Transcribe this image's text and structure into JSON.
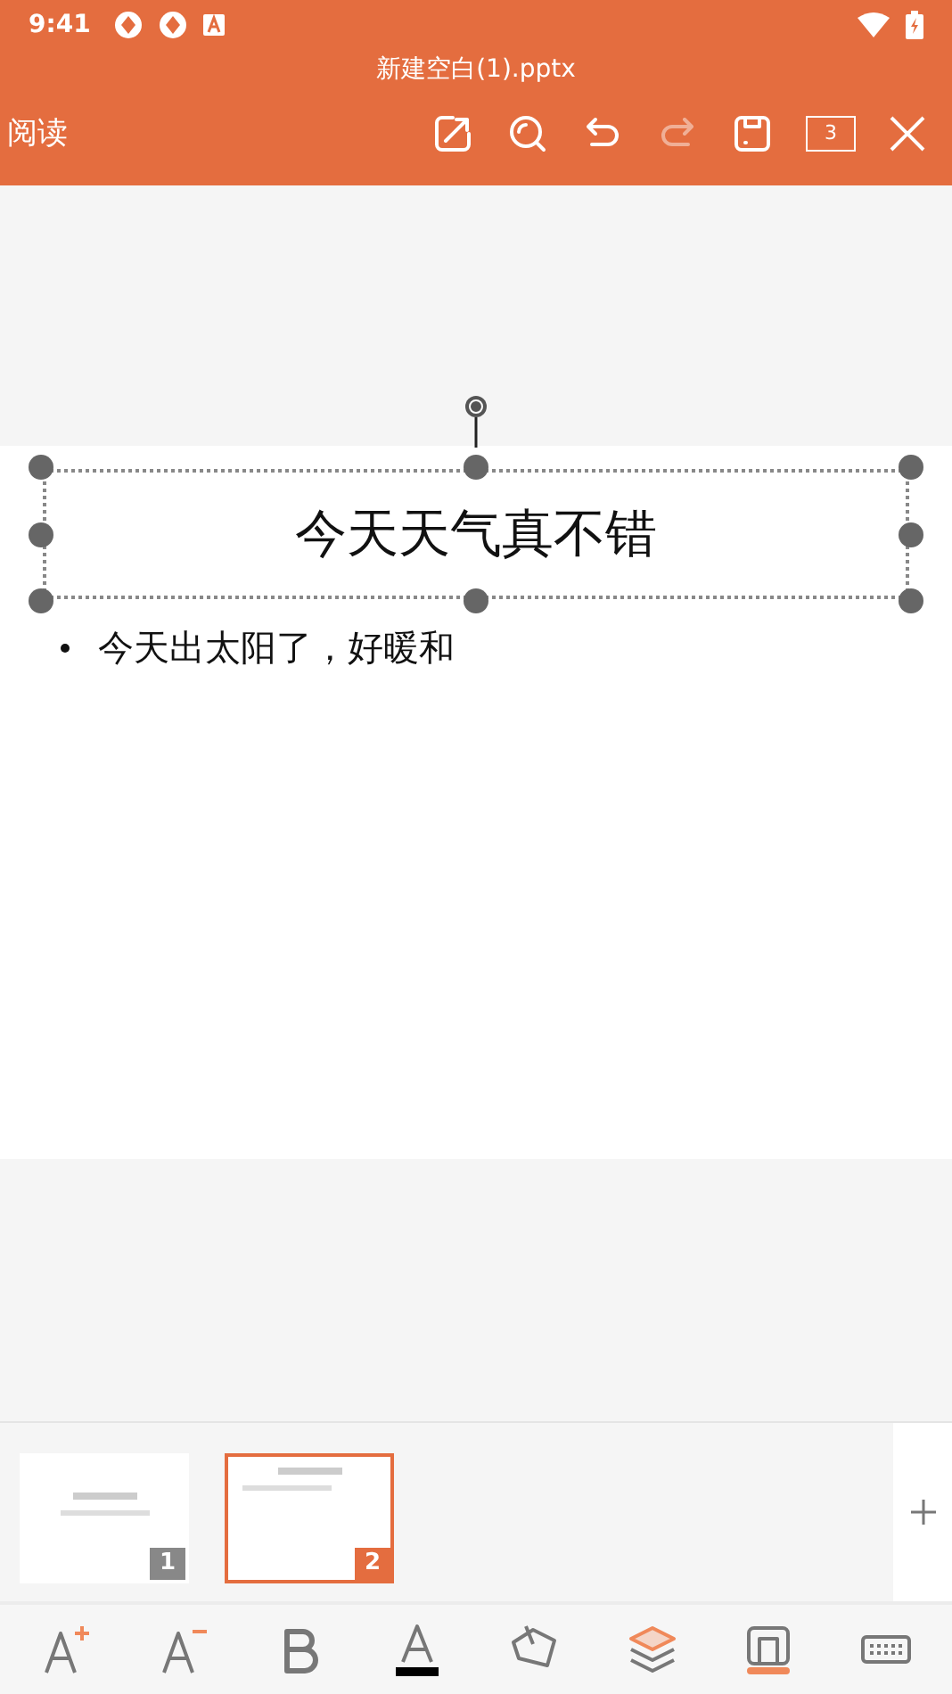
{
  "status_bar": {
    "time": "9:41"
  },
  "title": "新建空白(1).pptx",
  "toolbar": {
    "mode": "阅读",
    "actions": [
      {
        "kind": "share",
        "disabled": false
      },
      {
        "kind": "search",
        "disabled": false
      },
      {
        "kind": "undo",
        "disabled": false
      },
      {
        "kind": "redo",
        "disabled": true
      },
      {
        "kind": "save",
        "disabled": false
      }
    ],
    "slide_count": "3"
  },
  "slide": {
    "title": "今天天气真不错",
    "title_selected": true,
    "bullets": [
      "今天出太阳了，好暖和"
    ]
  },
  "thumbnails": [
    {
      "number": "1",
      "selected": false
    },
    {
      "number": "2",
      "selected": true
    }
  ],
  "format_tools": [
    {
      "kind": "grow-font",
      "highlighted": false
    },
    {
      "kind": "shrink-font",
      "highlighted": false
    },
    {
      "kind": "bold",
      "highlighted": false
    },
    {
      "kind": "font-color",
      "highlighted": false
    },
    {
      "kind": "fill",
      "highlighted": false
    },
    {
      "kind": "layers",
      "highlighted": true
    },
    {
      "kind": "border",
      "highlighted": false
    },
    {
      "kind": "keyboard",
      "highlighted": false
    }
  ]
}
